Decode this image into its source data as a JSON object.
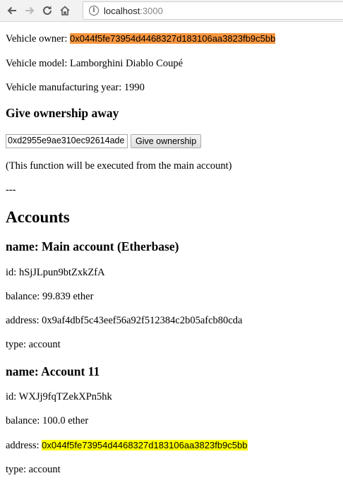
{
  "browser": {
    "url_host": "localhost",
    "url_port": ":3000",
    "info_glyph": "i"
  },
  "vehicle": {
    "owner_label": "Vehicle owner: ",
    "owner_value": "0x044f5fe73954d4468327d183106aa3823fb9c5bb",
    "model_label": "Vehicle model: ",
    "model_value": "Lamborghini Diablo Coupé",
    "year_label": "Vehicle manufacturing year: ",
    "year_value": "1990"
  },
  "give_ownership": {
    "heading": "Give ownership away",
    "input_value": "0xd2955e9ae310ec92614ade",
    "button_label": "Give ownership",
    "note": "(This function will be executed from the main account)"
  },
  "separator": "---",
  "accounts": {
    "heading": "Accounts",
    "items": [
      {
        "name_line": "name: Main account (Etherbase)",
        "id_label": "id: ",
        "id": "hSjJLpun9btZxkZfA",
        "balance_label": "balance: ",
        "balance": "99.839 ether",
        "address_label": "address: ",
        "address": "0x9af4dbf5c43eef56a92f512384c2b05afcb80cda",
        "type_label": "type: ",
        "type": "account"
      },
      {
        "name_line": "name: Account 11",
        "id_label": "id: ",
        "id": "WXJj9fqTZekXPn5hk",
        "balance_label": "balance: ",
        "balance": "100.0 ether",
        "address_label": "address: ",
        "address": "0x044f5fe73954d4468327d183106aa3823fb9c5bb",
        "type_label": "type: ",
        "type": "account"
      }
    ]
  },
  "colors": {
    "owner_highlight": "#f7963f",
    "address_highlight": "#ffff00"
  },
  "icons": [
    "back-arrow-icon",
    "forward-arrow-icon",
    "reload-icon",
    "home-icon",
    "info-icon"
  ]
}
